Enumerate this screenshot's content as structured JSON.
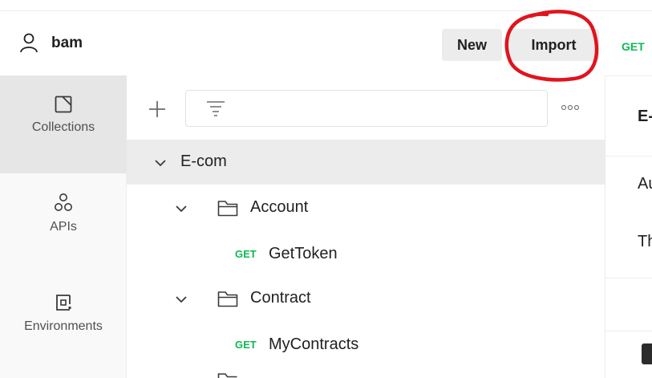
{
  "header": {
    "workspace_name": "bam",
    "new_label": "New",
    "import_label": "Import"
  },
  "nav": {
    "collections_label": "Collections",
    "apis_label": "APIs",
    "environments_label": "Environments"
  },
  "collection": {
    "name": "E-com",
    "folders": [
      {
        "name": "Account",
        "requests": [
          {
            "method": "GET",
            "name": "GetToken"
          }
        ]
      },
      {
        "name": "Contract",
        "requests": [
          {
            "method": "GET",
            "name": "MyContracts"
          }
        ]
      }
    ]
  },
  "right_pane": {
    "method": "GET",
    "title_partial": "E-",
    "line1_partial": "Au",
    "line2_partial": "Th"
  },
  "colors": {
    "get_method": "#0cbb52",
    "annotation": "#e0141e",
    "selected_row": "#ececec"
  },
  "icons": [
    "user-icon",
    "collections-icon",
    "apis-icon",
    "environments-icon",
    "plus-icon",
    "filter-icon",
    "more-icon",
    "chevron-down-icon",
    "folder-icon"
  ]
}
